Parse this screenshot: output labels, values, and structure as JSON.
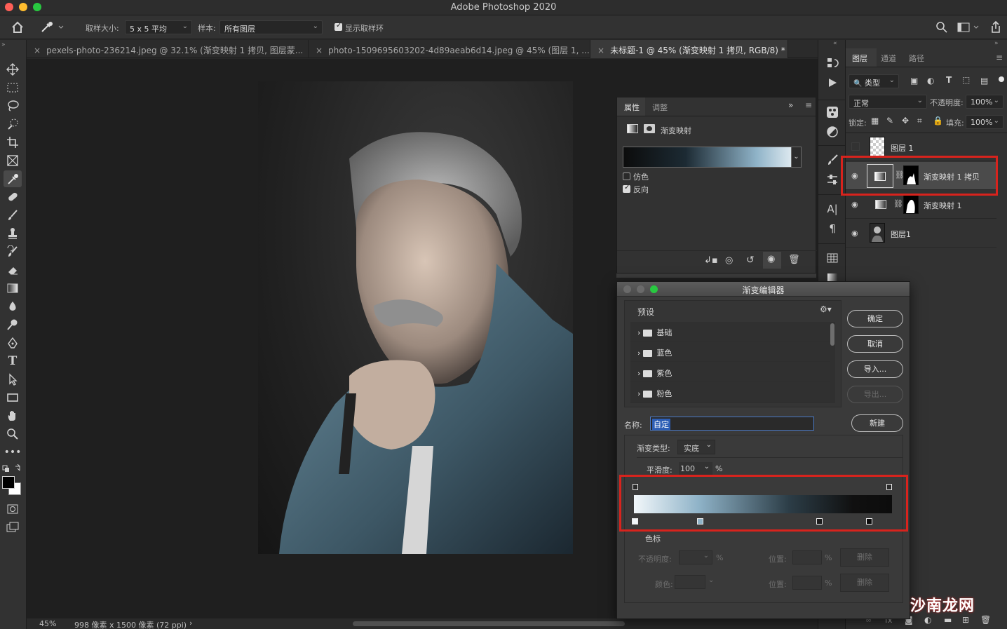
{
  "app": {
    "title": "Adobe Photoshop 2020"
  },
  "options_bar": {
    "sample_size_label": "取样大小:",
    "sample_size_value": "5 x 5 平均",
    "sample_label": "样本:",
    "sample_value": "所有图层",
    "show_ring_label": "显示取样环",
    "show_ring_checked": true
  },
  "tabs": [
    {
      "label": "pexels-photo-236214.jpeg @ 32.1% (渐变映射 1 拷贝, 图层蒙...",
      "active": false
    },
    {
      "label": "photo-1509695603202-4d89aeab6d14.jpeg @ 45% (图层 1, ...",
      "active": false
    },
    {
      "label": "未标题-1 @ 45% (渐变映射 1 拷贝, RGB/8) *",
      "active": true
    }
  ],
  "status": {
    "zoom": "45%",
    "doc_info": "998 像素 x 1500 像素 (72 ppi)"
  },
  "properties": {
    "tab_props": "属性",
    "tab_adjust": "调整",
    "adjust_name": "渐变映射",
    "dither_label": "仿色",
    "dither_checked": false,
    "reverse_label": "反向",
    "reverse_checked": true
  },
  "layers_panel": {
    "tabs": [
      "图层",
      "通道",
      "路径"
    ],
    "filter_kind": "类型",
    "blend_mode": "正常",
    "opacity_label": "不透明度:",
    "opacity_value": "100%",
    "lock_label": "锁定:",
    "fill_label": "填充:",
    "fill_value": "100%",
    "layers": [
      {
        "name": "图层 1",
        "visible": false,
        "selected": false
      },
      {
        "name": "渐变映射 1 拷贝",
        "visible": true,
        "selected": true
      },
      {
        "name": "渐变映射 1",
        "visible": true,
        "selected": false
      },
      {
        "name": "图层1",
        "visible": true,
        "selected": false
      }
    ]
  },
  "gradient_editor": {
    "title": "渐变编辑器",
    "presets_label": "预设",
    "presets": [
      "基础",
      "蓝色",
      "紫色",
      "粉色"
    ],
    "ok": "确定",
    "cancel": "取消",
    "import": "导入...",
    "export": "导出...",
    "name_label": "名称:",
    "name_value": "自定",
    "new_button": "新建",
    "type_label": "渐变类型:",
    "type_value": "实底",
    "smooth_label": "平滑度:",
    "smooth_value": "100",
    "smooth_unit": "%",
    "stops_label": "色标",
    "opacity_label": "不透明度:",
    "opacity_unit": "%",
    "location_label": "位置:",
    "location_unit": "%",
    "delete_label": "删除",
    "color_label": "颜色:",
    "color_location_label": "位置:",
    "color_location_unit": "%",
    "color_delete_label": "删除"
  },
  "colors": {
    "highlight": "#d8231d",
    "gradient_start": "#f2f7fa",
    "gradient_mid": "#8fb3c8",
    "gradient_end": "#0c0c0c",
    "selection_blue": "#2d5eb5"
  },
  "watermark": "沙南龙网"
}
